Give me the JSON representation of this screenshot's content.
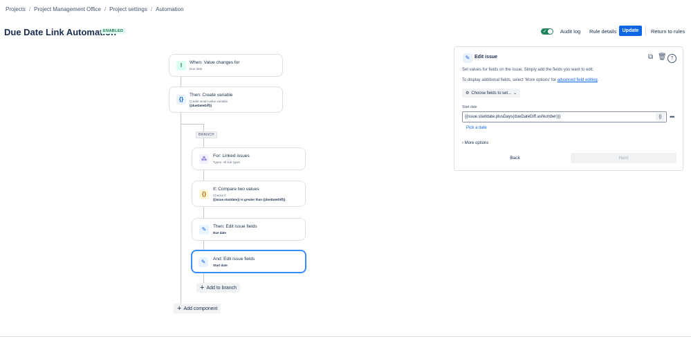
{
  "breadcrumb": [
    "Projects",
    "Project Management Office",
    "Project settings",
    "Automation"
  ],
  "header": {
    "title": "Due Date Link Automation",
    "status": "ENABLED",
    "audit_log": "Audit log",
    "rule_details": "Rule details",
    "update": "Update",
    "return": "Return to rules"
  },
  "flow": {
    "trigger": {
      "title": "When: Value changes for",
      "sub": "Due date"
    },
    "variable": {
      "title": "Then: Create variable",
      "sub": "Create smart value variable",
      "sub2": "{{dueDateDiff}}"
    },
    "branch_label": "BRANCH",
    "branch_for": {
      "title": "For: Linked issues",
      "sub": "Types: All link types"
    },
    "condition": {
      "title": "If: Compare two values",
      "sub": "Checks if",
      "sub2": "{{issue.startdate}} is greater than {{dueDateDiff}}"
    },
    "edit1": {
      "title": "Then: Edit issue fields",
      "sub": "Due date"
    },
    "edit2": {
      "title": "And: Edit issue fields",
      "sub": "Start date"
    },
    "add_to_branch": "Add to branch",
    "add_component": "Add component"
  },
  "panel": {
    "title": "Edit issue",
    "desc1": "Set values for fields on the issue. Simply add the fields you want to edit.",
    "desc2_prefix": "To display additional fields, select 'More options' for",
    "desc2_link": "advanced field editing",
    "desc2_suffix": ".",
    "choose_fields": "Choose fields to set...",
    "field_label": "Start date",
    "field_value": "{{issue.startdate.plusDays(dueDateDiff.asNumber)}}",
    "pick_date": "Pick a date",
    "more_options": "More options",
    "back": "Back",
    "next": "Next"
  }
}
